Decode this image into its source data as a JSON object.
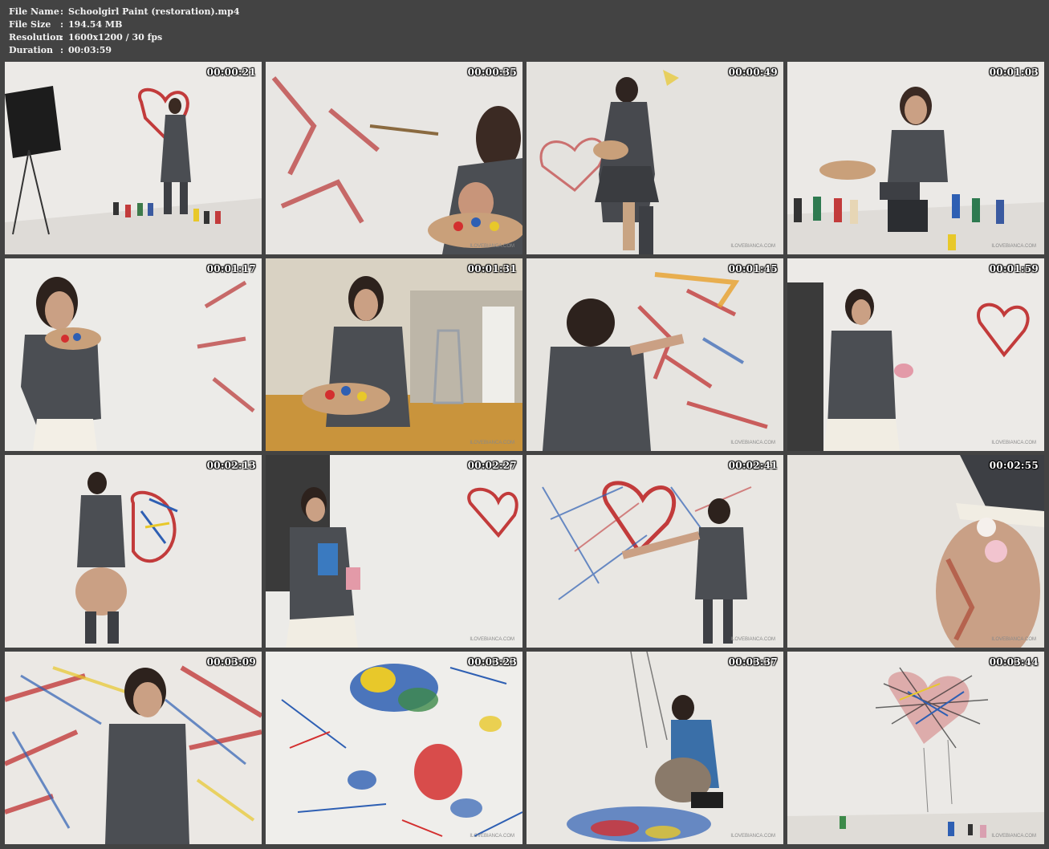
{
  "info": {
    "rows": [
      {
        "key": "File Name",
        "sep": ":",
        "value": "Schoolgirl Paint (restoration).mp4"
      },
      {
        "key": "File Size",
        "sep": ":",
        "value": "194.54 MB"
      },
      {
        "key": "Resolution",
        "sep": ":",
        "value": "1600x1200 / 30 fps"
      },
      {
        "key": "Duration",
        "sep": ":",
        "value": "00:03:59"
      }
    ]
  },
  "thumbnails": [
    {
      "timestamp": "00:00:21"
    },
    {
      "timestamp": "00:00:35",
      "watermark": "ILOVEBIANCA.COM"
    },
    {
      "timestamp": "00:00:49",
      "watermark": "ILOVEBIANCA.COM"
    },
    {
      "timestamp": "00:01:03",
      "watermark": "ILOVEBIANCA.COM"
    },
    {
      "timestamp": "00:01:17"
    },
    {
      "timestamp": "00:01:31",
      "watermark": "ILOVEBIANCA.COM"
    },
    {
      "timestamp": "00:01:45",
      "watermark": "ILOVEBIANCA.COM"
    },
    {
      "timestamp": "00:01:59",
      "watermark": "ILOVEBIANCA.COM"
    },
    {
      "timestamp": "00:02:13"
    },
    {
      "timestamp": "00:02:27",
      "watermark": "ILOVEBIANCA.COM"
    },
    {
      "timestamp": "00:02:41",
      "watermark": "ILOVEBIANCA.COM"
    },
    {
      "timestamp": "00:02:55",
      "watermark": "ILOVEBIANCA.COM"
    },
    {
      "timestamp": "00:03:09"
    },
    {
      "timestamp": "00:03:23",
      "watermark": "ILOVEBIANCA.COM"
    },
    {
      "timestamp": "00:03:37",
      "watermark": "ILOVEBIANCA.COM"
    },
    {
      "timestamp": "00:03:44",
      "watermark": "ILOVEBIANCA.COM"
    }
  ]
}
